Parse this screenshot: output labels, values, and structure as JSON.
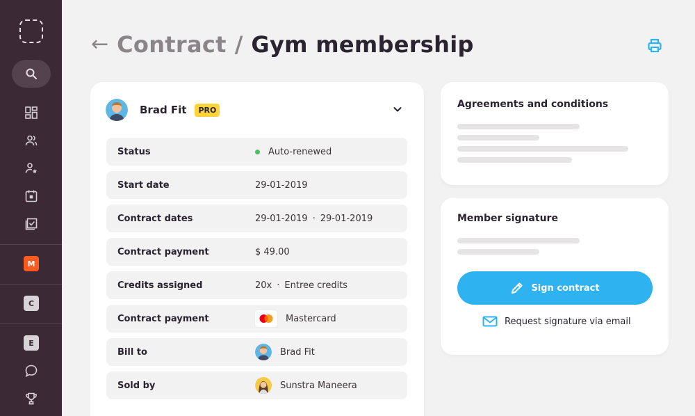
{
  "sidebar": {
    "items": [
      {
        "icon": "logo-placeholder-icon"
      },
      {
        "icon": "search-icon"
      },
      {
        "icon": "dashboard-icon"
      },
      {
        "icon": "users-icon"
      },
      {
        "icon": "user-star-icon"
      },
      {
        "icon": "calendar-icon"
      },
      {
        "icon": "checklist-icon"
      },
      {
        "icon": "badge-m",
        "label": "M",
        "color": "#ff5a1f"
      },
      {
        "icon": "badge-c",
        "label": "C",
        "color": "#d8d3d6"
      },
      {
        "icon": "badge-e",
        "label": "E",
        "color": "#d8d3d6"
      },
      {
        "icon": "chat-icon"
      },
      {
        "icon": "trophy-icon"
      }
    ]
  },
  "header": {
    "back_icon": "←",
    "parent": "Contract",
    "separator": "/",
    "title": "Gym membership",
    "print_icon": "printer-icon"
  },
  "member": {
    "name": "Brad Fit",
    "badge": "PRO"
  },
  "rows": [
    {
      "label": "Status",
      "value": "Auto-renewed"
    },
    {
      "label": "Start date",
      "value": "29-01-2019"
    },
    {
      "label": "Contract dates",
      "value_from": "29-01-2019",
      "value_sep": "·",
      "value_to": "29-01-2019"
    },
    {
      "label": "Contract payment",
      "value": "$ 49.00"
    },
    {
      "label": "Credits assigned",
      "value_count": "20x",
      "value_sep": "·",
      "value_type": "Entree credits"
    },
    {
      "label": "Contract payment",
      "value": "Mastercard"
    },
    {
      "label": "Bill to",
      "value": "Brad Fit"
    },
    {
      "label": "Sold by",
      "value": "Sunstra Maneera"
    }
  ],
  "agreements": {
    "title": "Agreements and conditions"
  },
  "signature": {
    "title": "Member signature",
    "sign_button": "Sign contract",
    "email_link": "Request signature via email"
  },
  "colors": {
    "sidebar": "#3b2a36",
    "accent": "#2fb3f0",
    "pro_badge": "#ffd43a",
    "status_green": "#47c068"
  }
}
